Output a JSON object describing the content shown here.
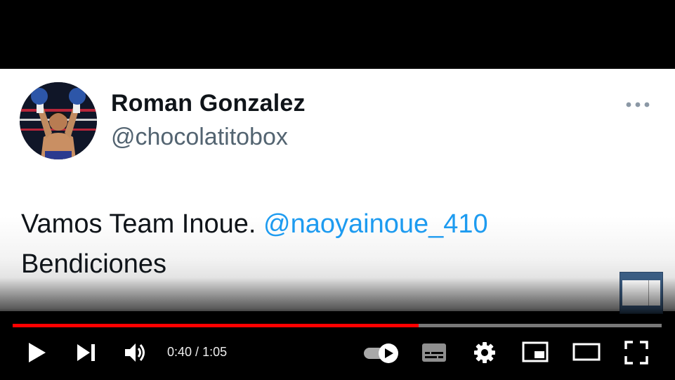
{
  "tweet": {
    "author_name": "Roman Gonzalez",
    "author_handle": "@chocolatitobox",
    "text": "Vamos Team Inoue.",
    "mention": "@naoyainoue_410",
    "text_line2": "Bendiciones",
    "more_icon": "more-horizontal-icon"
  },
  "player": {
    "current_time": "0:40",
    "separator": " / ",
    "duration": "1:05",
    "progress_fraction": 0.625,
    "colors": {
      "progress_played": "#ff0000",
      "mention": "#1d9bf0"
    },
    "icons": [
      "play-icon",
      "next-icon",
      "volume-icon",
      "autoplay-toggle-icon",
      "subtitles-icon",
      "settings-icon",
      "miniplayer-icon",
      "theater-mode-icon",
      "fullscreen-icon"
    ]
  }
}
